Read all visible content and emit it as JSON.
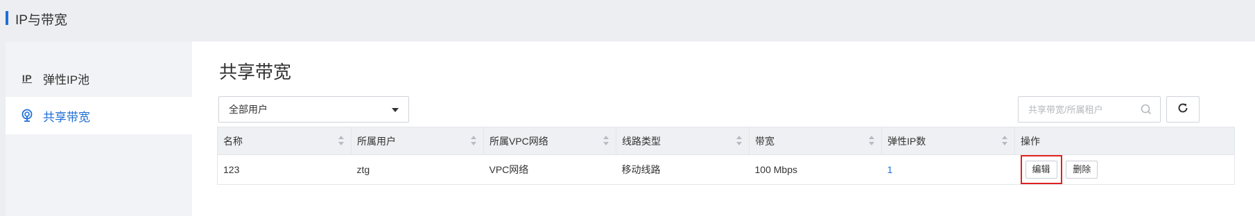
{
  "header": {
    "title": "IP与带宽"
  },
  "sidebar": {
    "items": [
      {
        "icon_text": "IP",
        "label": "弹性IP池"
      },
      {
        "icon": "bandwidth-icon",
        "label": "共享带宽"
      }
    ]
  },
  "main": {
    "title": "共享带宽",
    "filter": {
      "selected": "全部用户"
    },
    "search": {
      "placeholder": "共享带宽/所属租户"
    },
    "table": {
      "columns": [
        "名称",
        "所属用户",
        "所属VPC网络",
        "线路类型",
        "带宽",
        "弹性IP数",
        "操作"
      ],
      "rows": [
        {
          "name": "123",
          "user": "ztg",
          "vpc": "VPC网络",
          "line_type": "移动线路",
          "bandwidth": "100 Mbps",
          "eip_count": "1",
          "actions": {
            "edit": "编辑",
            "delete": "删除"
          }
        }
      ]
    }
  },
  "colors": {
    "accent": "#1f6fd6",
    "highlight": "#e02020"
  }
}
